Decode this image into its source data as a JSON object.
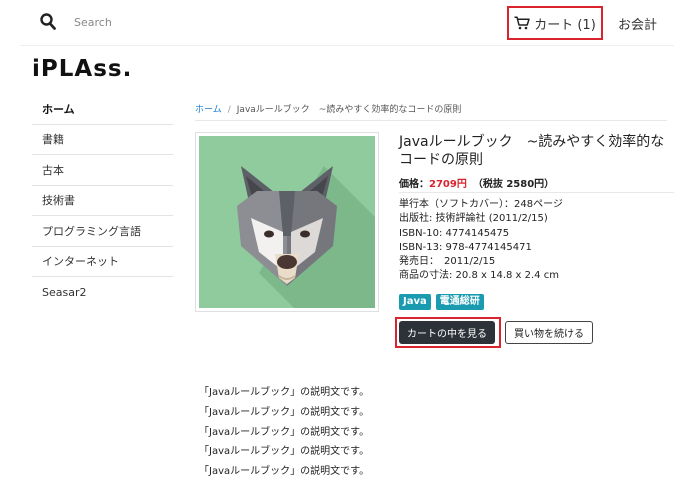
{
  "header": {
    "search_placeholder": "Search",
    "cart_label": "カート (1)",
    "checkout_label": "お会計",
    "accent_color": "#d9232d"
  },
  "logo": {
    "text": "iPLAss."
  },
  "sidebar": {
    "items": [
      {
        "label": "ホーム",
        "active": true
      },
      {
        "label": "書籍"
      },
      {
        "label": "古本"
      },
      {
        "label": "技術書"
      },
      {
        "label": "プログラミング言語"
      },
      {
        "label": "インターネット"
      },
      {
        "label": "Seasar2"
      }
    ]
  },
  "breadcrumb": {
    "home": "ホーム",
    "separator": "/",
    "current": "Javaルールブック　~読みやすく効率的なコードの原則"
  },
  "product": {
    "title": "Javaルールブック　~読みやすく効率的なコードの原則",
    "price_label": "価格：",
    "price_value": "2709円",
    "price_tax": "（税抜 2580円）",
    "specs": [
      "単行本（ソフトカバー）：248ページ",
      "出版社: 技術評論社 (2011/2/15)",
      "ISBN-10: 4774145475",
      "ISBN-13: 978-4774145471",
      "発売日：　2011/2/15",
      "商品の寸法: 20.8 x 14.8 x 2.4 cm"
    ],
    "tags": [
      "Java",
      "電通総研"
    ],
    "view_cart_button": "カートの中を見る",
    "continue_button": "買い物を続ける",
    "image_icon": "wolf-icon"
  },
  "description": {
    "lines": [
      "「Javaルールブック」の説明文です。",
      "「Javaルールブック」の説明文です。",
      "「Javaルールブック」の説明文です。",
      "「Javaルールブック」の説明文です。",
      "「Javaルールブック」の説明文です。"
    ]
  }
}
